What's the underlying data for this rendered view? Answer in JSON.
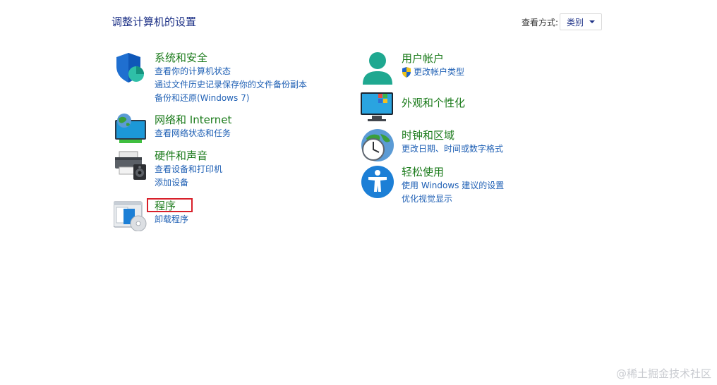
{
  "header": {
    "title": "调整计算机的设置",
    "view_by_label": "查看方式:",
    "view_by_value": "类别"
  },
  "categories": {
    "system_security": {
      "title": "系统和安全",
      "links": [
        "查看你的计算机状态",
        "通过文件历史记录保存你的文件备份副本",
        "备份和还原(Windows 7)"
      ]
    },
    "network": {
      "title": "网络和 Internet",
      "links": [
        "查看网络状态和任务"
      ]
    },
    "hardware_sound": {
      "title": "硬件和声音",
      "links": [
        "查看设备和打印机",
        "添加设备"
      ]
    },
    "programs": {
      "title": "程序",
      "links": [
        "卸载程序"
      ]
    },
    "user_accounts": {
      "title": "用户帐户",
      "links": [
        "更改帐户类型"
      ]
    },
    "appearance": {
      "title": "外观和个性化",
      "links": []
    },
    "clock_region": {
      "title": "时钟和区域",
      "links": [
        "更改日期、时间或数字格式"
      ]
    },
    "ease_of_access": {
      "title": "轻松使用",
      "links": [
        "使用 Windows 建议的设置",
        "优化视觉显示"
      ]
    }
  },
  "watermark": "@稀土掘金技术社区",
  "colors": {
    "title_blue": "#1e3287",
    "category_green": "#1a7a1a",
    "link_blue": "#1e5fb4",
    "highlight_red": "#d8202a"
  },
  "icons": [
    "shield-pie-icon",
    "globe-monitor-icon",
    "printer-speaker-icon",
    "programs-disc-icon",
    "user-icon",
    "uac-shield-icon",
    "monitor-color-icon",
    "clock-globe-icon",
    "accessibility-icon",
    "caret-down-icon"
  ]
}
